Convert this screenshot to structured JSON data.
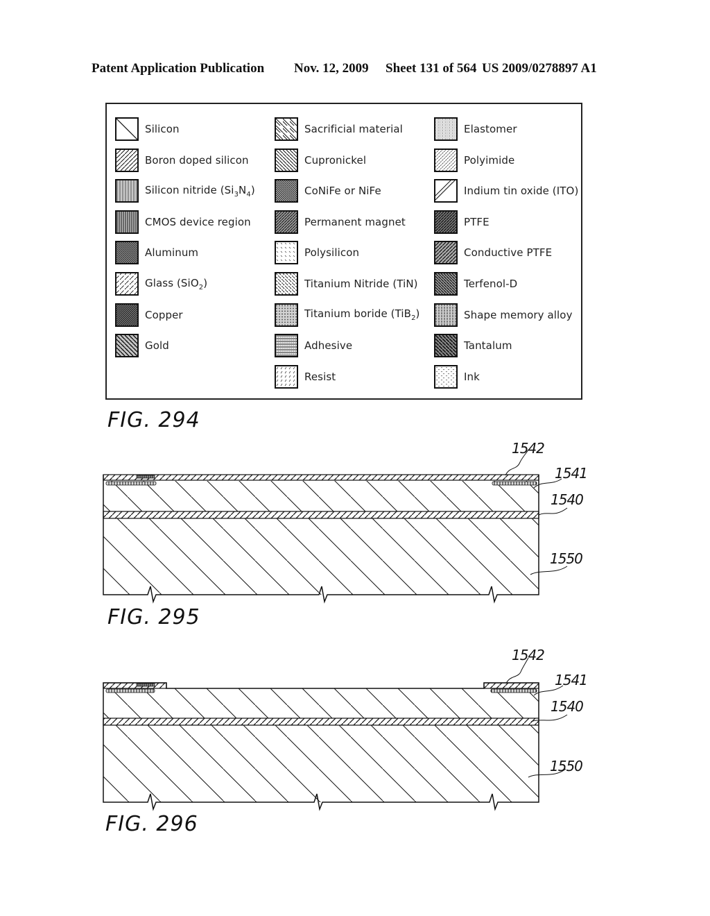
{
  "header": {
    "publication": "Patent Application Publication",
    "date": "Nov. 12, 2009",
    "sheet": "Sheet 131 of 564",
    "number": "US 2009/0278897 A1"
  },
  "legend": {
    "figure": "FIG. 294",
    "columns": [
      [
        {
          "label": "Silicon",
          "pattern": "silicon"
        },
        {
          "label": "Boron doped silicon",
          "pattern": "boron"
        },
        {
          "label": "Silicon nitride (Si",
          "sub1": "3",
          "mid": "N",
          "sub2": "4",
          "end": ")",
          "pattern": "nitride"
        },
        {
          "label": "CMOS device region",
          "pattern": "cmos"
        },
        {
          "label": "Aluminum",
          "pattern": "aluminum"
        },
        {
          "label": "Glass (SiO",
          "sub1": "2",
          "end": ")",
          "pattern": "glass"
        },
        {
          "label": "Copper",
          "pattern": "copper"
        },
        {
          "label": "Gold",
          "pattern": "gold"
        }
      ],
      [
        {
          "label": "Sacrificial material",
          "pattern": "sacrificial"
        },
        {
          "label": "Cupronickel",
          "pattern": "cupronickel"
        },
        {
          "label": "CoNiFe or NiFe",
          "pattern": "conife"
        },
        {
          "label": "Permanent magnet",
          "pattern": "magnet"
        },
        {
          "label": "Polysilicon",
          "pattern": "polysilicon"
        },
        {
          "label": "Titanium Nitride (TiN)",
          "pattern": "tin"
        },
        {
          "label": "Titanium boride (TiB",
          "sub1": "2",
          "end": ")",
          "pattern": "tib"
        },
        {
          "label": "Adhesive",
          "pattern": "adhesive"
        },
        {
          "label": "Resist",
          "pattern": "resist"
        }
      ],
      [
        {
          "label": "Elastomer",
          "pattern": "elastomer"
        },
        {
          "label": "Polyimide",
          "pattern": "polyimide"
        },
        {
          "label": "Indium tin oxide (ITO)",
          "pattern": "ito"
        },
        {
          "label": "PTFE",
          "pattern": "ptfe"
        },
        {
          "label": "Conductive PTFE",
          "pattern": "cptfe"
        },
        {
          "label": "Terfenol-D",
          "pattern": "terfenol"
        },
        {
          "label": "Shape memory alloy",
          "pattern": "sma"
        },
        {
          "label": "Tantalum",
          "pattern": "tantalum"
        },
        {
          "label": "Ink",
          "pattern": "ink"
        }
      ]
    ]
  },
  "figures": [
    {
      "id": "fig295",
      "label": "FIG. 295",
      "refs": {
        "r1542": "1542",
        "r1541": "1541",
        "r1540": "1540",
        "r1550": "1550"
      }
    },
    {
      "id": "fig296",
      "label": "FIG. 296",
      "refs": {
        "r1542": "1542",
        "r1541": "1541",
        "r1540": "1540",
        "r1550": "1550"
      }
    }
  ]
}
